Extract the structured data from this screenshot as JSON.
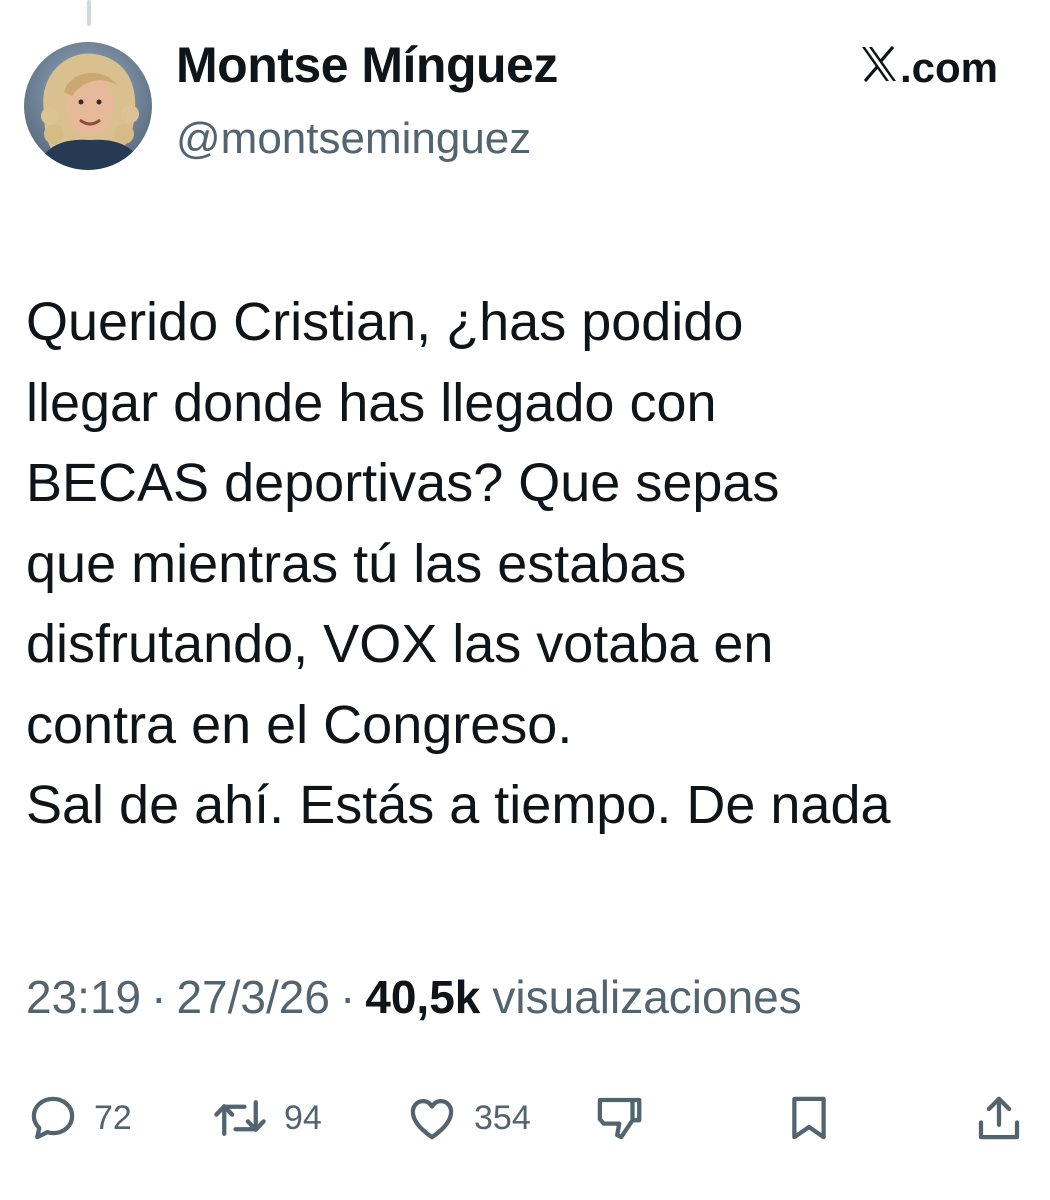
{
  "author": {
    "display_name": "Montse Mínguez",
    "handle": "@montseminguez",
    "avatar_icon": "profile-photo"
  },
  "source": {
    "logo_icon": "x-logo-icon",
    "label": ".com"
  },
  "tweet": {
    "lines": [
      "Querido Cristian, ¿has podido",
      "llegar donde has llegado con",
      "BECAS deportivas? Que sepas",
      "que mientras tú las estabas",
      "disfrutando, VOX las votaba en",
      "contra en el Congreso.",
      "Sal de ahí. Estás a tiempo. De nada"
    ]
  },
  "meta": {
    "time": "23:19",
    "separator": "·",
    "date": "27/3/26",
    "views_count": "40,5k",
    "views_label": "visualizaciones"
  },
  "actions": {
    "reply": {
      "icon": "reply-icon",
      "count": "72"
    },
    "repost": {
      "icon": "repost-icon",
      "count": "94"
    },
    "like": {
      "icon": "heart-icon",
      "count": "354"
    },
    "dislike": {
      "icon": "thumbs-down-icon"
    },
    "bookmark": {
      "icon": "bookmark-icon"
    },
    "share": {
      "icon": "share-icon"
    }
  },
  "colors": {
    "text_primary": "#0f1419",
    "text_secondary": "#536471",
    "thread_line": "#cfd9de"
  }
}
